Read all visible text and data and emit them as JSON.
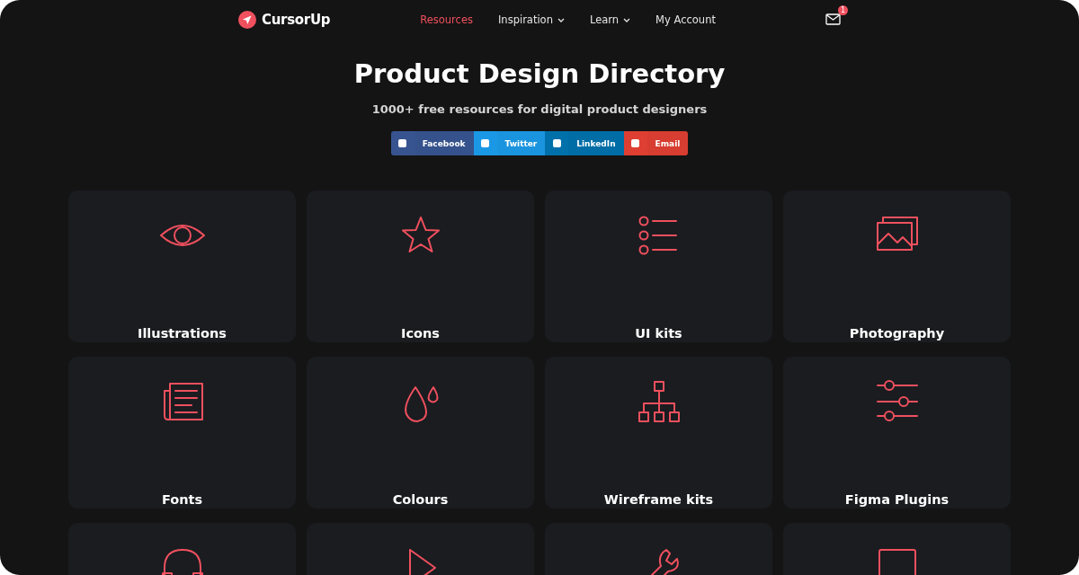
{
  "header": {
    "logo": "CursorUp",
    "nav": [
      {
        "label": "Resources",
        "selected": true,
        "dropdown": false
      },
      {
        "label": "Inspiration",
        "selected": false,
        "dropdown": true
      },
      {
        "label": "Learn",
        "selected": false,
        "dropdown": true
      },
      {
        "label": "My Account",
        "selected": false,
        "dropdown": false
      }
    ],
    "mail_badge": "1"
  },
  "hero": {
    "title": "Product Design Directory",
    "subtitle": "1000+ free resources for digital product designers"
  },
  "share": [
    {
      "label": "Facebook",
      "color": "#3b5998"
    },
    {
      "label": "Twitter",
      "color": "#1da1f2"
    },
    {
      "label": "LinkedIn",
      "color": "#0077b5"
    },
    {
      "label": "Email",
      "color": "#ea4335"
    }
  ],
  "categories": [
    {
      "kind": "labeled",
      "label": "Illustrations"
    },
    {
      "kind": "labeled",
      "label": "Icons"
    },
    {
      "kind": "labeled",
      "label": "UI kits"
    },
    {
      "kind": "labeled",
      "label": "Photography"
    },
    {
      "kind": "labeled",
      "label": "Fonts"
    },
    {
      "kind": "labeled",
      "label": "Colours"
    },
    {
      "kind": "labeled",
      "label": "Wireframe kits"
    },
    {
      "kind": "labeled",
      "label": "Figma Plugins"
    },
    {
      "kind": "cut"
    },
    {
      "kind": "cut"
    },
    {
      "kind": "cut"
    },
    {
      "kind": "cut"
    }
  ]
}
